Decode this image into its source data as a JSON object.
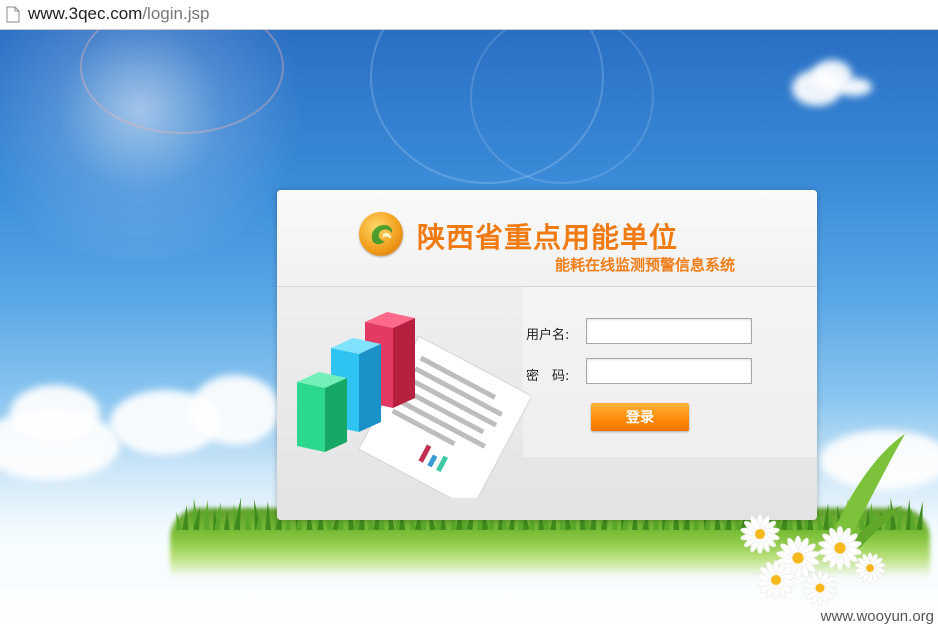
{
  "browser": {
    "url_host": "www.3qec.com",
    "url_path": "/login.jsp"
  },
  "login": {
    "title_main": "陕西省重点用能单位",
    "title_sub": "能耗在线监测预警信息系统",
    "username_label": "用户名:",
    "password_label": "密　码:",
    "username_value": "",
    "password_value": "",
    "submit_label": "登录"
  },
  "watermark": "www.wooyun.org",
  "colors": {
    "title": "#f07b12",
    "button": "#ff8d0c",
    "sky": "#3a8bd8"
  },
  "icons": [
    "page-icon",
    "logo-icon",
    "bar-chart-document-icon",
    "daisy-flowers"
  ]
}
